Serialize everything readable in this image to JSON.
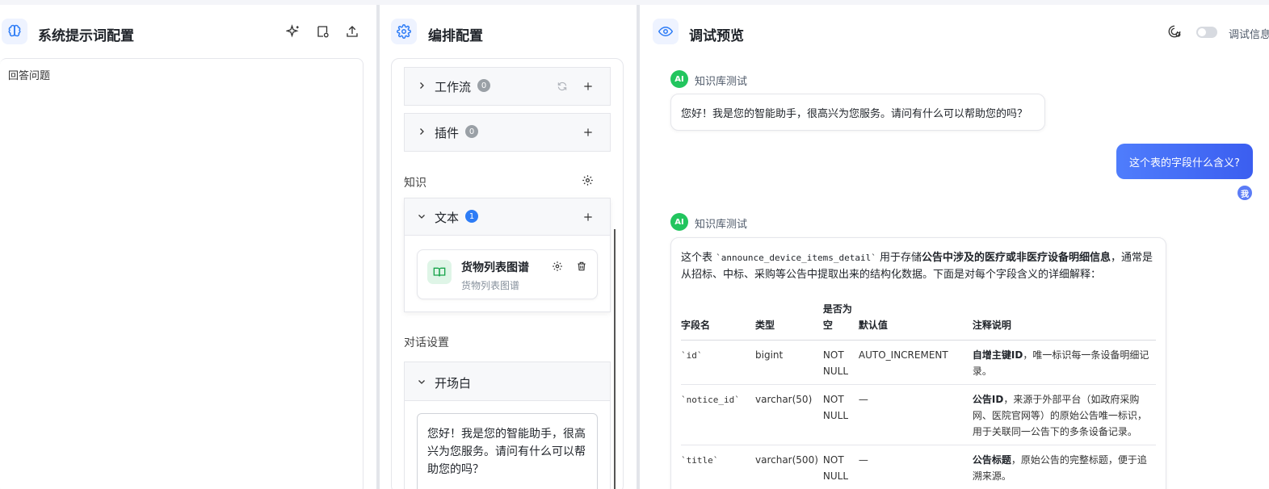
{
  "left_panel": {
    "title": "系统提示词配置",
    "prompt_text": "回答问题"
  },
  "mid_panel": {
    "title": "编排配置",
    "workflow": {
      "label": "工作流",
      "count": "0"
    },
    "plugin": {
      "label": "插件",
      "count": "0"
    },
    "knowledge": {
      "group_label": "知识",
      "text_section": {
        "label": "文本",
        "count": "1"
      },
      "card": {
        "title": "货物列表图谱",
        "subtitle": "货物列表图谱"
      }
    },
    "dialog": {
      "group_label": "对话设置",
      "opening": {
        "label": "开场白",
        "text": "您好！我是您的智能助手，很高兴为您服务。请问有什么可以帮助您的吗？"
      }
    }
  },
  "right_panel": {
    "title": "调试预览",
    "debug_label": "调试信息",
    "messages": {
      "ai1": {
        "avatar": "AI",
        "name": "知识库测试",
        "text": "您好！我是您的智能助手，很高兴为您服务。请问有什么可以帮助您的吗？"
      },
      "user1": {
        "text": "这个表的字段什么含义?",
        "avatar": "我"
      },
      "ai2": {
        "avatar": "AI",
        "name": "知识库测试",
        "intro_a": "这个表 ",
        "intro_code": "`announce_device_items_detail`",
        "intro_b": " 用于存储",
        "intro_bold": "公告中涉及的医疗或非医疗设备明细信息",
        "intro_c": "，通常是从招标、中标、采购等公告中提取出来的结构化数据。下面是对每个字段含义的详细解释：",
        "table": {
          "headers": [
            "字段名",
            "类型",
            "是否为空",
            "默认值",
            "注释说明"
          ],
          "rows": [
            {
              "field": "`id`",
              "type": "bigint",
              "nullable": "NOT NULL",
              "default": "AUTO_INCREMENT",
              "desc_bold": "自增主键ID",
              "desc": "，唯一标识每一条设备明细记录。"
            },
            {
              "field": "`notice_id`",
              "type": "varchar(50)",
              "nullable": "NOT NULL",
              "default": "—",
              "desc_bold": "公告ID",
              "desc": "，来源于外部平台（如政府采购网、医院官网等）的原始公告唯一标识，用于关联同一公告下的多条设备记录。"
            },
            {
              "field": "`title`",
              "type": "varchar(500)",
              "nullable": "NOT NULL",
              "default": "—",
              "desc_bold": "公告标题",
              "desc": "，原始公告的完整标题，便于追溯来源。"
            }
          ]
        }
      }
    }
  },
  "colors": {
    "accent": "#2d7cf6",
    "ai_green": "#22c55e",
    "user_bubble": "#4f7dfc"
  }
}
